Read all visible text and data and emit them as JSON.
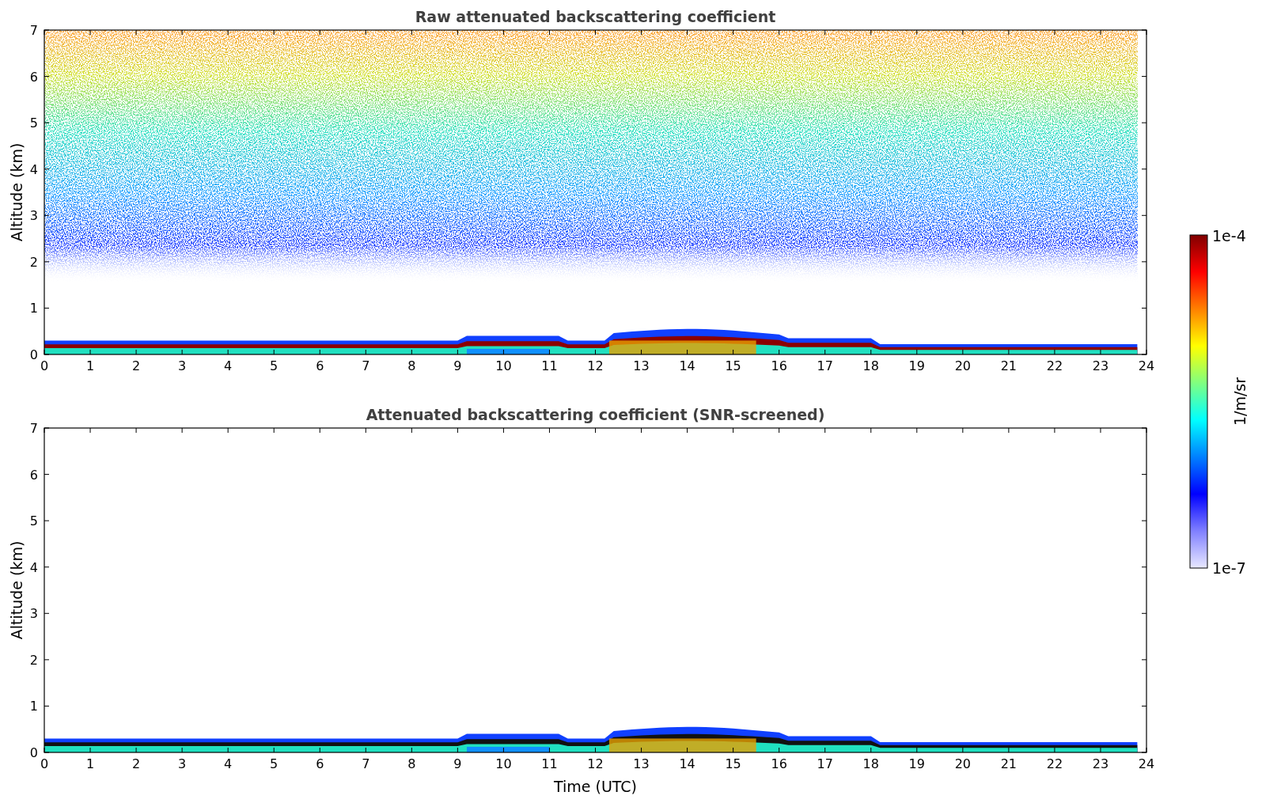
{
  "panels": [
    {
      "kind": "raw",
      "title": "Raw attenuated backscattering coefficient",
      "ylabel": "Altitude (km)",
      "yticks": [
        "7",
        "6",
        "5",
        "4",
        "3",
        "2",
        "1",
        "0"
      ],
      "xticks": [
        "0",
        "1",
        "2",
        "3",
        "4",
        "5",
        "6",
        "7",
        "8",
        "9",
        "10",
        "11",
        "12",
        "13",
        "14",
        "15",
        "16",
        "17",
        "18",
        "19",
        "20",
        "21",
        "22",
        "23",
        "24"
      ]
    },
    {
      "kind": "screened",
      "title": "Attenuated backscattering coefficient (SNR-screened)",
      "ylabel": "Altitude (km)",
      "xlabel": "Time (UTC)",
      "yticks": [
        "7",
        "6",
        "5",
        "4",
        "3",
        "2",
        "1",
        "0"
      ],
      "xticks": [
        "0",
        "1",
        "2",
        "3",
        "4",
        "5",
        "6",
        "7",
        "8",
        "9",
        "10",
        "11",
        "12",
        "13",
        "14",
        "15",
        "16",
        "17",
        "18",
        "19",
        "20",
        "21",
        "22",
        "23",
        "24"
      ]
    }
  ],
  "colorbar": {
    "max_label": "1e-4",
    "min_label": "1e-7",
    "label": "1/m/sr"
  }
}
